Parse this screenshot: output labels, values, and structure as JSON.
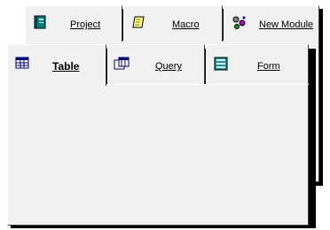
{
  "back_tabs": [
    {
      "label": "Project",
      "icon": "project-book-icon"
    },
    {
      "label": "Macro",
      "icon": "macro-scroll-icon"
    },
    {
      "label": "New Module",
      "icon": "module-gears-icon"
    }
  ],
  "front_tabs": [
    {
      "label": "Table",
      "icon": "table-grid-icon",
      "active": true
    },
    {
      "label": "Query",
      "icon": "query-icon"
    },
    {
      "label": "Form",
      "icon": "form-icon"
    }
  ]
}
